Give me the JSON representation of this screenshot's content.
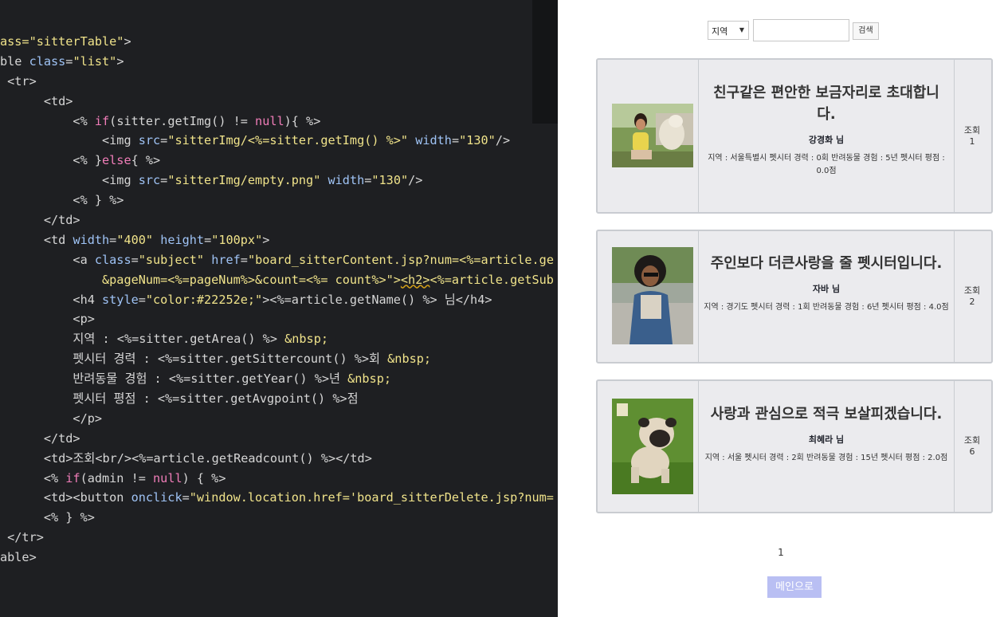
{
  "code_lines": [
    [
      [
        "str",
        "ass=\"sitterTable\""
      ],
      [
        "txt",
        ">"
      ]
    ],
    [
      [
        "txt",
        "ble "
      ],
      [
        "attr",
        "class"
      ],
      [
        "txt",
        "="
      ],
      [
        "str",
        "\"list\""
      ],
      [
        "txt",
        ">"
      ]
    ],
    [
      [
        "txt",
        " <tr>"
      ]
    ],
    [
      [
        "txt",
        "      <td>"
      ]
    ],
    [
      [
        "txt",
        "          <% "
      ],
      [
        "kw",
        "if"
      ],
      [
        "txt",
        "(sitter.getImg() != "
      ],
      [
        "kw",
        "null"
      ],
      [
        "txt",
        "){ %>"
      ]
    ],
    [
      [
        "txt",
        "              <img "
      ],
      [
        "attr",
        "src"
      ],
      [
        "txt",
        "="
      ],
      [
        "str",
        "\"sitterImg/<%=sitter.getImg() %>\""
      ],
      [
        "txt",
        " "
      ],
      [
        "attr",
        "width"
      ],
      [
        "txt",
        "="
      ],
      [
        "str",
        "\"130\""
      ],
      [
        "txt",
        "/>"
      ]
    ],
    [
      [
        "txt",
        "          <% }"
      ],
      [
        "kw",
        "else"
      ],
      [
        "txt",
        "{ %>"
      ]
    ],
    [
      [
        "txt",
        "              <img "
      ],
      [
        "attr",
        "src"
      ],
      [
        "txt",
        "="
      ],
      [
        "str",
        "\"sitterImg/empty.png\""
      ],
      [
        "txt",
        " "
      ],
      [
        "attr",
        "width"
      ],
      [
        "txt",
        "="
      ],
      [
        "str",
        "\"130\""
      ],
      [
        "txt",
        "/>"
      ]
    ],
    [
      [
        "txt",
        "          <% } %>"
      ]
    ],
    [
      [
        "txt",
        "      </td>"
      ]
    ],
    [
      [
        "txt",
        "      <td "
      ],
      [
        "attr",
        "width"
      ],
      [
        "txt",
        "="
      ],
      [
        "str",
        "\"400\""
      ],
      [
        "txt",
        " "
      ],
      [
        "attr",
        "height"
      ],
      [
        "txt",
        "="
      ],
      [
        "str",
        "\"100px\""
      ],
      [
        "txt",
        ">"
      ]
    ],
    [
      [
        "txt",
        "          <a "
      ],
      [
        "attr",
        "class"
      ],
      [
        "txt",
        "="
      ],
      [
        "str",
        "\"subject\""
      ],
      [
        "txt",
        " "
      ],
      [
        "attr",
        "href"
      ],
      [
        "txt",
        "="
      ],
      [
        "str",
        "\"board_sitterContent.jsp?num=<%=article.ge"
      ]
    ],
    [
      [
        "str",
        "              &pageNum=<%=pageNum%>&count=<%= count%>\">"
      ],
      [
        "sq",
        "<h2>"
      ],
      [
        "str",
        "<%=article.getSub"
      ]
    ],
    [
      [
        "txt",
        "          <h4 "
      ],
      [
        "attr",
        "style"
      ],
      [
        "txt",
        "="
      ],
      [
        "str",
        "\"color:#22252e;\""
      ],
      [
        "txt",
        "><%=article.getName() %> 님</h4>"
      ]
    ],
    [
      [
        "txt",
        "          <p>"
      ]
    ],
    [
      [
        "txt",
        "          지역 : <%=sitter.getArea() %> "
      ],
      [
        "ent",
        "&nbsp;"
      ]
    ],
    [
      [
        "txt",
        "          펫시터 경력 : <%=sitter.getSittercount() %>회 "
      ],
      [
        "ent",
        "&nbsp;"
      ]
    ],
    [
      [
        "txt",
        "          반려동물 경험 : <%=sitter.getYear() %>년 "
      ],
      [
        "ent",
        "&nbsp;"
      ]
    ],
    [
      [
        "txt",
        "          펫시터 평점 : <%=sitter.getAvgpoint() %>점"
      ]
    ],
    [
      [
        "txt",
        "          </p>"
      ]
    ],
    [
      [
        "txt",
        "      </td>"
      ]
    ],
    [
      [
        "txt",
        "      <td>조회<br/><%=article.getReadcount() %></td>"
      ]
    ],
    [
      [
        "txt",
        "      <% "
      ],
      [
        "kw",
        "if"
      ],
      [
        "txt",
        "(admin != "
      ],
      [
        "kw",
        "null"
      ],
      [
        "txt",
        ") { %>"
      ]
    ],
    [
      [
        "txt",
        "      <td><button "
      ],
      [
        "attr",
        "onclick"
      ],
      [
        "txt",
        "="
      ],
      [
        "str",
        "\"window.location.href='board_sitterDelete.jsp?num="
      ]
    ],
    [
      [
        "txt",
        "      <% } %>"
      ]
    ],
    [
      [
        "txt",
        " </tr>"
      ]
    ],
    [
      [
        "txt",
        "able>"
      ]
    ]
  ],
  "search": {
    "region_select": "지역",
    "keyword_value": "",
    "button_label": "검색"
  },
  "posts": [
    {
      "title": "친구같은 편안한 보금자리로 초대합니다.",
      "name": "강경화 님",
      "info": "지역 : 서울특별시   펫시터 경력 : 0회   반려동물 경험 : 5년   펫시터 평점 : 0.0점",
      "views_label": "조회",
      "views": "1"
    },
    {
      "title": "주인보다 더큰사랑을 줄 펫시터입니다.",
      "name": "자바 님",
      "info": "지역 : 경기도   펫시터 경력 : 1회   반려동물 경험 : 6년   펫시터 평점 : 4.0점",
      "views_label": "조회",
      "views": "2"
    },
    {
      "title": "사랑과 관심으로 적극 보살피겠습니다.",
      "name": "최혜라 님",
      "info": "지역 : 서울   펫시터 경력 : 2회   반려동물 경험 : 15년   펫시터 평점 : 2.0점",
      "views_label": "조회",
      "views": "6"
    }
  ],
  "pagination": {
    "current": "1"
  },
  "main_button": "메인으로",
  "colors": {
    "editor_bg": "#1e1f22",
    "string": "#f0e38a",
    "attr": "#9fc3f5",
    "keyword": "#f07db8",
    "main_button": "#b9bff3"
  }
}
